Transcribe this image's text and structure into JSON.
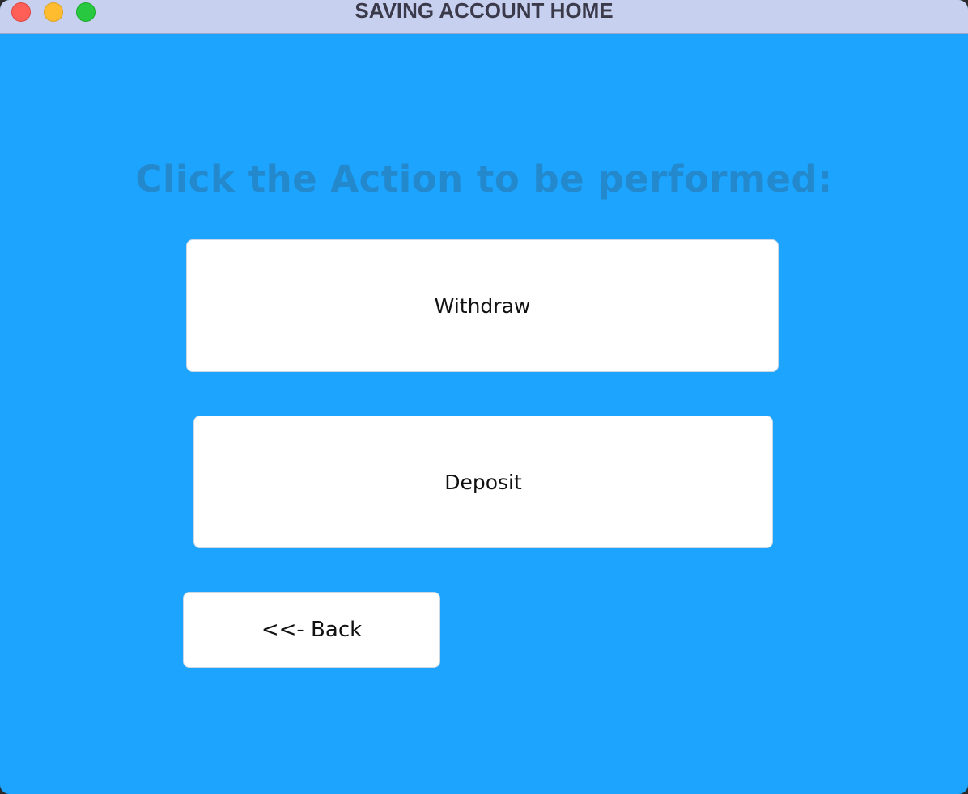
{
  "window": {
    "title": "SAVING ACCOUNT HOME"
  },
  "main": {
    "heading": "Click the Action to be performed:",
    "buttons": {
      "withdraw": "Withdraw",
      "deposit": "Deposit",
      "back": "<<- Back"
    }
  },
  "colors": {
    "background": "#1ca4fe",
    "heading": "#2388cc",
    "titlebar": "#c8d0f0",
    "button": "#ffffff"
  }
}
